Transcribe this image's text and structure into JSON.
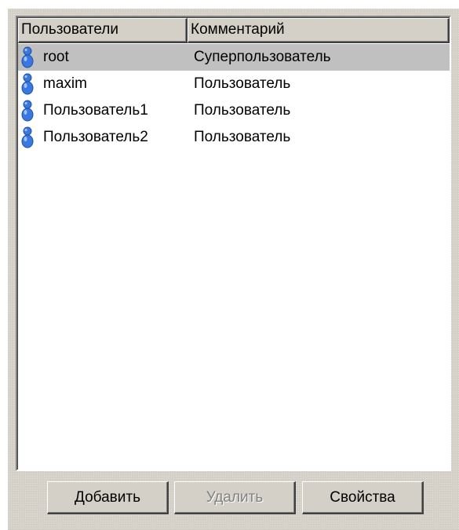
{
  "listview": {
    "columns": {
      "users": "Пользователи",
      "comment": "Комментарий"
    },
    "rows": [
      {
        "name": "root",
        "comment": "Суперпользователь",
        "selected": true
      },
      {
        "name": "maxim",
        "comment": "Пользователь",
        "selected": false
      },
      {
        "name": "Пользователь1",
        "comment": "Пользователь",
        "selected": false
      },
      {
        "name": "Пользователь2",
        "comment": "Пользователь",
        "selected": false
      }
    ],
    "row_icon": "user-icon"
  },
  "buttons": {
    "add": "Добавить",
    "delete": "Удалить",
    "properties": "Свойства"
  },
  "colors": {
    "icon_blue": "#3a78e0",
    "selection": "#c0c0c0",
    "face": "#d4d0c8"
  }
}
